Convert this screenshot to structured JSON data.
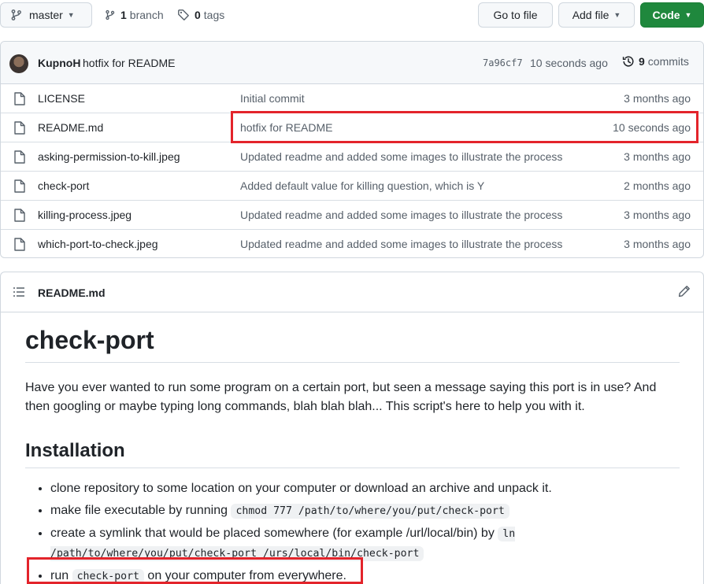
{
  "toolbar": {
    "branch_label": "master",
    "branches_count": "1",
    "branches_word": "branch",
    "tags_count": "0",
    "tags_word": "tags",
    "go_to_file": "Go to file",
    "add_file": "Add file",
    "code": "Code"
  },
  "commit": {
    "author": "KupnoH",
    "message": "hotfix for README",
    "sha": "7a96cf7",
    "time": "10 seconds ago",
    "count": "9",
    "count_word": "commits"
  },
  "files": [
    {
      "name": "LICENSE",
      "commit": "Initial commit",
      "age": "3 months ago"
    },
    {
      "name": "README.md",
      "commit": "hotfix for README",
      "age": "10 seconds ago"
    },
    {
      "name": "asking-permission-to-kill.jpeg",
      "commit": "Updated readme and added some images to illustrate the process",
      "age": "3 months ago"
    },
    {
      "name": "check-port",
      "commit": "Added default value for killing question, which is Y",
      "age": "2 months ago"
    },
    {
      "name": "killing-process.jpeg",
      "commit": "Updated readme and added some images to illustrate the process",
      "age": "3 months ago"
    },
    {
      "name": "which-port-to-check.jpeg",
      "commit": "Updated readme and added some images to illustrate the process",
      "age": "3 months ago"
    }
  ],
  "readme": {
    "filename": "README.md",
    "h1": "check-port",
    "intro": "Have you ever wanted to run some program on a certain port, but seen a message saying this port is in use? And then googling or maybe typing long commands, blah blah blah... This script's here to help you with it.",
    "h2": "Installation",
    "items": {
      "i0": "clone repository to some location on your computer or download an archive and unpack it.",
      "i1_text": "make file executable by running ",
      "i1_code": "chmod 777 /path/to/where/you/put/check-port",
      "i2_text": "create a symlink that would be placed somewhere (for example /url/local/bin) by ",
      "i2_code": "ln /path/to/where/you/put/check-port /urs/local/bin/check-port",
      "i3_pre": "run ",
      "i3_code": "check-port",
      "i3_post": " on your computer from everywhere."
    }
  },
  "colors": {
    "code_button": "#1f883d",
    "highlight": "#e3242b"
  }
}
